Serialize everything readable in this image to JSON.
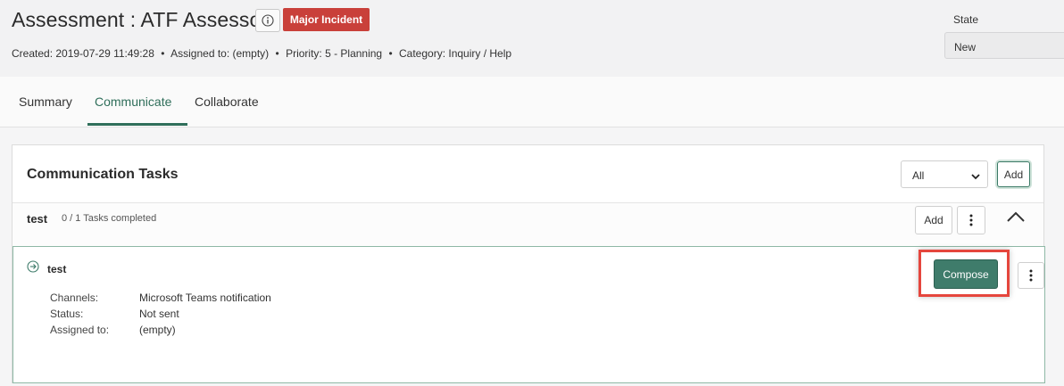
{
  "header": {
    "title": "Assessment : ATF Assessor",
    "badge": "Major Incident",
    "meta": {
      "created": "Created: 2019-07-29 11:49:28",
      "assigned": "Assigned to: (empty)",
      "priority": "Priority: 5 - Planning",
      "category": "Category: Inquiry / Help",
      "separator": "•"
    },
    "state_label": "State",
    "state_value": "New"
  },
  "tabs": [
    {
      "label": "Summary"
    },
    {
      "label": "Communicate",
      "active": true
    },
    {
      "label": "Collaborate"
    }
  ],
  "panel": {
    "title": "Communication Tasks",
    "filter_value": "All",
    "add_label": "Add"
  },
  "group": {
    "name": "test",
    "progress": "0 / 1 Tasks completed",
    "add_label": "Add"
  },
  "task": {
    "name": "test",
    "compose_label": "Compose",
    "details": [
      {
        "label": "Channels:",
        "value": "Microsoft Teams notification"
      },
      {
        "label": "Status:",
        "value": "Not sent"
      },
      {
        "label": "Assigned to:",
        "value": "(empty)"
      }
    ]
  },
  "colors": {
    "accent": "#2f6e5a",
    "badge": "#c9403a",
    "highlight": "#e5463d",
    "compose": "#3f7c6b"
  },
  "icons": {
    "info": "info-icon",
    "more": "more-vertical-icon",
    "collapse": "chevron-up-icon",
    "task": "arrow-right-circle-icon",
    "select": "chevron-down-icon"
  }
}
